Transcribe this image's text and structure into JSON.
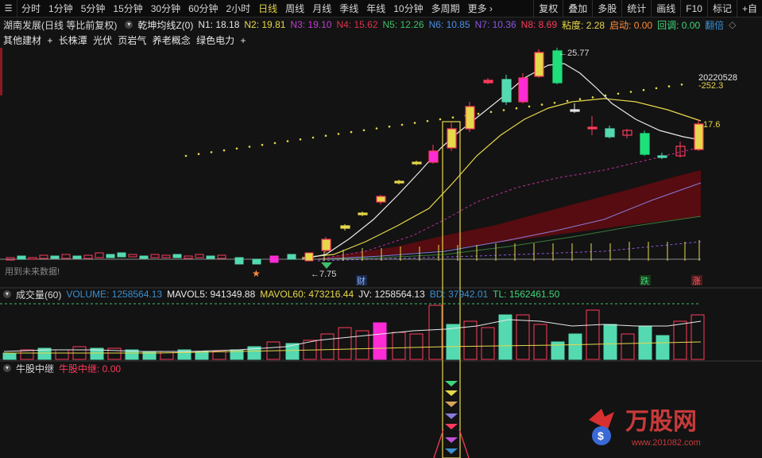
{
  "toolbar": {
    "periods": [
      "分时",
      "1分钟",
      "5分钟",
      "15分钟",
      "30分钟",
      "60分钟",
      "2小时",
      "日线",
      "周线",
      "月线",
      "季线",
      "年线",
      "10分钟",
      "多周期",
      "更多"
    ],
    "active_period": "日线",
    "right_buttons": [
      "复权",
      "叠加",
      "多股",
      "统计",
      "画线",
      "F10",
      "标记",
      "+自"
    ]
  },
  "info": {
    "stock": "湖南发展(日线 等比前复权)",
    "indicator": "乾坤均线Z(0)",
    "n1": "N1: 18.18",
    "n2": "N2: 19.81",
    "n3": "N3: 19.10",
    "n4": "N4: 15.62",
    "n5": "N5: 12.26",
    "n6": "N6: 10.85",
    "n7": "N7: 10.36",
    "n8": "N8: 8.69",
    "zhandu": "粘度: 2.28",
    "qidong": "启动: 0.00",
    "huitiao": "回调: 0.00",
    "fanbei": "翻倍"
  },
  "tags": [
    "其他建材",
    "长株潭",
    "光伏",
    "页岩气",
    "养老概念",
    "绿色电力"
  ],
  "chart_labels": {
    "high": "25.77",
    "date": "20220528",
    "dotlevel": "252.3",
    "right_price": "17.6",
    "low": "7.75",
    "future": "用到未来数据!",
    "cai": "财",
    "die": "跌",
    "zhang": "涨"
  },
  "volume": {
    "title": "成交量(60)",
    "volume": "VOLUME: 1258564.13",
    "mavol5": "MAVOL5: 941349.88",
    "mavol60": "MAVOL60: 473216.44",
    "jv": "JV: 1258564.13",
    "bd": "BD: 37942.01",
    "tl": "TL: 1562461.50"
  },
  "sub": {
    "title": "牛股中继",
    "value": "牛股中继: 0.00"
  },
  "watermark": {
    "brand": "万股网",
    "url": "www.201082.com"
  },
  "colors": {
    "up": "#ff3b5c",
    "down": "#54d9b0",
    "yellow": "#e6d84a",
    "magenta": "#ff2bd6",
    "green_candle": "#1ee07a"
  }
}
